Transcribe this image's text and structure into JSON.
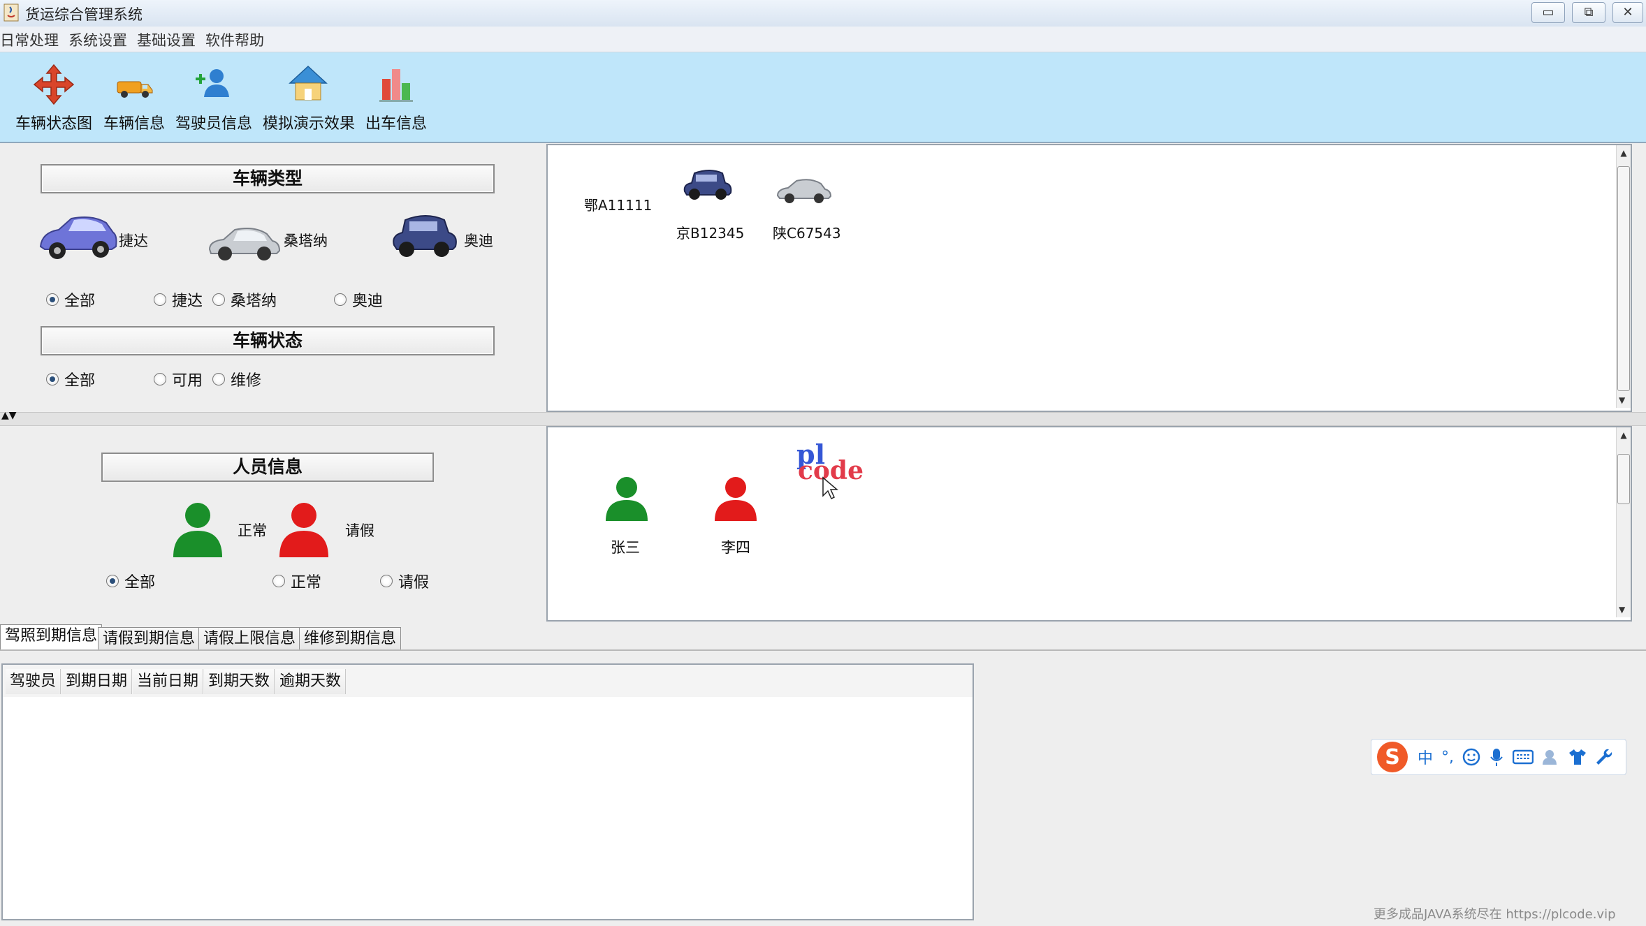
{
  "window": {
    "title": "货运综合管理系统"
  },
  "menubar": [
    "日常处理",
    "系统设置",
    "基础设置",
    "软件帮助"
  ],
  "toolbar": [
    {
      "label": "车辆状态图",
      "icon": "move-arrows-icon"
    },
    {
      "label": "车辆信息",
      "icon": "truck-icon"
    },
    {
      "label": "驾驶员信息",
      "icon": "add-user-icon"
    },
    {
      "label": "模拟演示效果",
      "icon": "house-icon"
    },
    {
      "label": "出车信息",
      "icon": "bar-chart-icon"
    }
  ],
  "vehicle_type": {
    "header": "车辆类型",
    "cars": [
      {
        "label": "捷达",
        "color": "#6e74d8"
      },
      {
        "label": "桑塔纳",
        "color": "#c9cdd2"
      },
      {
        "label": "奥迪",
        "color": "#3c4a87"
      }
    ],
    "options": [
      "全部",
      "捷达",
      "桑塔纳",
      "奥迪"
    ],
    "selected": "全部"
  },
  "vehicle_status": {
    "header": "车辆状态",
    "options": [
      "全部",
      "可用",
      "维修"
    ],
    "selected": "全部"
  },
  "vehicles": [
    {
      "plate": "鄂A11111"
    },
    {
      "plate": "京B12345"
    },
    {
      "plate": "陕C67543"
    }
  ],
  "personnel": {
    "header": "人员信息",
    "legend": [
      {
        "label": "正常",
        "color": "#1a8f2a"
      },
      {
        "label": "请假",
        "color": "#e21b1b"
      }
    ],
    "options": [
      "全部",
      "正常",
      "请假"
    ],
    "selected": "全部"
  },
  "people": [
    {
      "name": "张三",
      "color": "#1a8f2a"
    },
    {
      "name": "李四",
      "color": "#e21b1b"
    }
  ],
  "overlay_logo": {
    "top": "pl",
    "bottom": "code"
  },
  "tabs": [
    "驾照到期信息",
    "请假到期信息",
    "请假上限信息",
    "维修到期信息"
  ],
  "active_tab": "驾照到期信息",
  "table": {
    "columns": [
      "驾驶员",
      "到期日期",
      "当前日期",
      "到期天数",
      "逾期天数"
    ],
    "rows": []
  },
  "ime": {
    "mode": "中",
    "punct": "°,"
  },
  "watermark": "更多成品JAVA系统尽在 https://plcode.vip"
}
